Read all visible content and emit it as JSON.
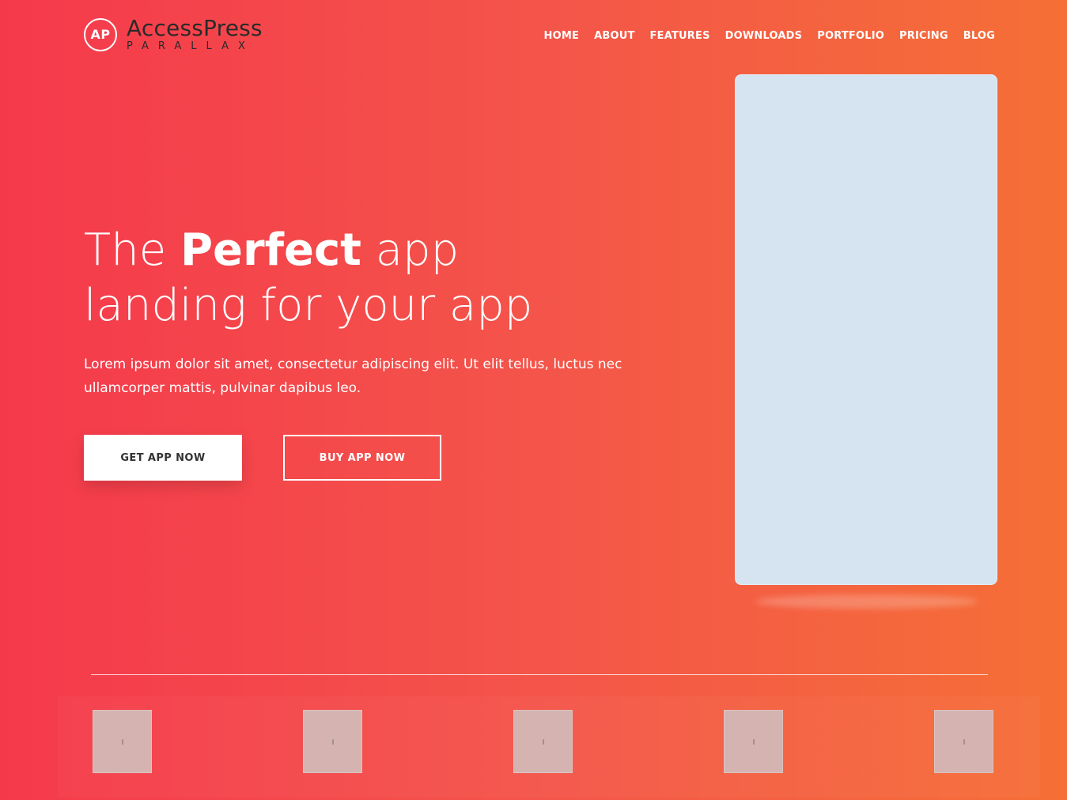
{
  "brand": {
    "badge": "AP",
    "name": "AccessPress",
    "tagline": "PARALLAX"
  },
  "nav": {
    "items": [
      {
        "label": "HOME"
      },
      {
        "label": "ABOUT"
      },
      {
        "label": "FEATURES"
      },
      {
        "label": "DOWNLOADS"
      },
      {
        "label": "PORTFOLIO"
      },
      {
        "label": "PRICING"
      },
      {
        "label": "BLOG"
      }
    ]
  },
  "hero": {
    "title_pre": "The ",
    "title_bold": "Perfect",
    "title_post": " app",
    "title_line2": "landing for your app",
    "description": "Lorem ipsum dolor sit amet, consectetur adipiscing elit. Ut elit tellus, luctus nec ullamcorper mattis, pulvinar dapibus leo.",
    "primary_cta": "GET APP NOW",
    "secondary_cta": "BUY APP NOW"
  },
  "colors": {
    "gradient_start": "#f5394c",
    "gradient_end": "#f56f36",
    "phone_screen": "#d6e3f1",
    "thumb_placeholder": "#d4b3b0"
  },
  "gallery": {
    "thumbnail_count": 5
  }
}
